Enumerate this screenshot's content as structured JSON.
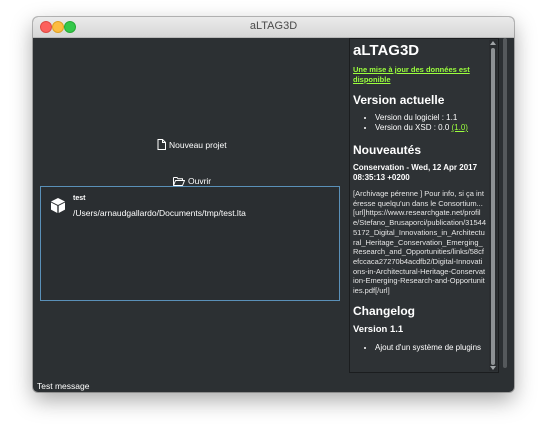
{
  "window": {
    "title": "aLTAG3D"
  },
  "left": {
    "new_project_label": "Nouveau projet",
    "open_label": "Ouvrir",
    "recent": {
      "name": "test",
      "path": "/Users/arnaudgallardo/Documents/tmp/test.lta"
    }
  },
  "status": {
    "message": "Test message"
  },
  "side": {
    "app_title": "aLTAG3D",
    "update_link": "Une mise à jour des données est disponible",
    "current_version_heading": "Version actuelle",
    "software_version": "Version du logiciel : 1.1",
    "xsd_version_prefix": "Version du XSD : 0.0",
    "xsd_version_link": "(1.0)",
    "news_heading": "Nouveautés",
    "news_title": "Conservation - Wed, 12 Apr 2017 08:35:13 +0200",
    "news_body": "[Archivage pérenne ] Pour info, si ça intéresse quelqu'un dans le Consortium... [url]https://www.researchgate.net/profile/Stefano_Brusaporci/publication/315445172_Digital_Innovations_in_Architectural_Heritage_Conservation_Emerging_Research_and_Opportunities/links/58cfefccaca27270b4acdfb2/Digital-Innovations-in-Architectural-Heritage-Conservation-Emerging-Research-and-Opportunities.pdf[/url]",
    "changelog_heading": "Changelog",
    "changelog_version": "Version 1.1",
    "changelog_item": "Ajout d'un système de plugins"
  }
}
